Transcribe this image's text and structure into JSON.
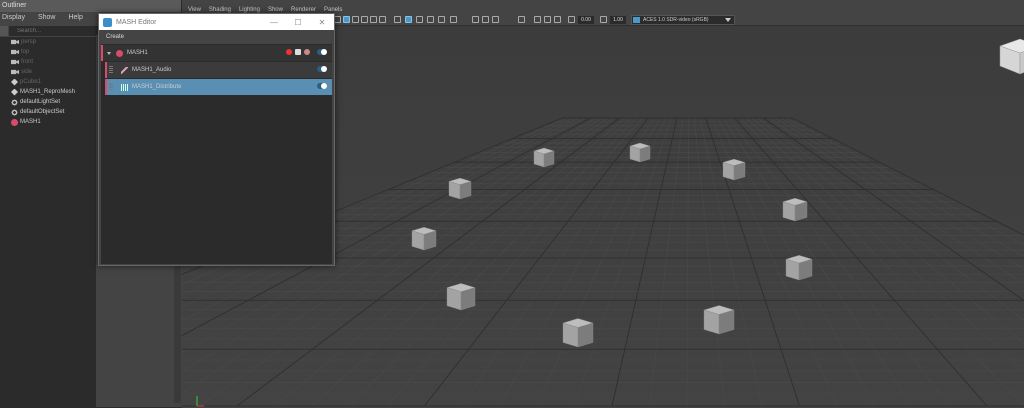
{
  "outliner": {
    "title": "Outliner",
    "menu": [
      "Display",
      "Show",
      "Help"
    ],
    "search_placeholder": "Search...",
    "items": [
      {
        "label": "persp",
        "icon": "camera-icon",
        "dim": true
      },
      {
        "label": "top",
        "icon": "camera-icon",
        "dim": true
      },
      {
        "label": "front",
        "icon": "camera-icon",
        "dim": true
      },
      {
        "label": "side",
        "icon": "camera-icon",
        "dim": true
      },
      {
        "label": "pCube1",
        "icon": "transform-icon",
        "dim": true
      },
      {
        "label": "MASH1_ReproMesh",
        "icon": "transform-icon",
        "dim": false
      },
      {
        "label": "defaultLightSet",
        "icon": "set-icon",
        "dim": false
      },
      {
        "label": "defaultObjectSet",
        "icon": "set-icon",
        "dim": false
      },
      {
        "label": "MASH1",
        "icon": "mash-icon",
        "dim": false
      }
    ]
  },
  "viewport": {
    "menu": [
      "View",
      "Shading",
      "Lighting",
      "Show",
      "Renderer",
      "Panels"
    ],
    "toolbar": {
      "exposure": "0.00",
      "gamma": "1.00",
      "color_space": "ACES 1.0 SDR-video (sRGB)"
    }
  },
  "mash_editor": {
    "title": "MASH Editor",
    "menu": "Create",
    "network": {
      "label": "MASH1",
      "enabled": true
    },
    "nodes": [
      {
        "label": "MASH1_Audio",
        "enabled": true,
        "selected": false
      },
      {
        "label": "MASH1_Distribute",
        "enabled": true,
        "selected": true
      }
    ]
  },
  "colors": {
    "accent": "#d94b6a",
    "selection": "#5a8fb4",
    "toggle": "#2c5d85"
  }
}
